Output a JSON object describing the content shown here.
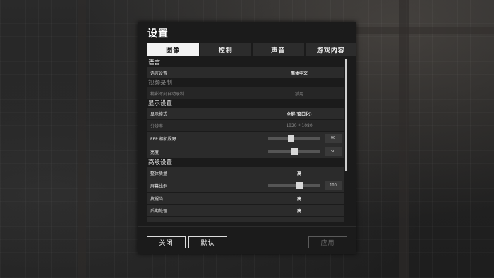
{
  "dialog": {
    "title": "设置"
  },
  "tabs": [
    {
      "label": "图像",
      "active": true
    },
    {
      "label": "控制",
      "active": false
    },
    {
      "label": "声音",
      "active": false
    },
    {
      "label": "游戏内容",
      "active": false
    }
  ],
  "sections": {
    "language": "语言",
    "video_record": "视频录制",
    "display": "显示设置",
    "advanced": "高级设置"
  },
  "rows": {
    "language": {
      "label": "语言设置",
      "value": "简体中文"
    },
    "highlight": {
      "label": "精彩时刻自动录制",
      "value": "禁用"
    },
    "display_mode": {
      "label": "显示模式",
      "value": "全屏(窗口化)"
    },
    "resolution": {
      "label": "分辨率",
      "value": "1920 * 1080"
    },
    "fpp_fov": {
      "label": "FPP 相机视野",
      "value": "90",
      "level": 0.43
    },
    "brightness": {
      "label": "亮度",
      "value": "50",
      "level": 0.5
    },
    "overall_quality": {
      "label": "整体质量",
      "value": "高"
    },
    "screen_scale": {
      "label": "屏幕比例",
      "value": "100",
      "level": 0.6
    },
    "anti_aliasing": {
      "label": "抗锯齿",
      "value": "高"
    },
    "post_processing": {
      "label": "后期处理",
      "value": "高"
    }
  },
  "buttons": {
    "close": "关闭",
    "default": "默认",
    "apply": "应用"
  },
  "colors": {
    "active_tab": "#f2f2f2",
    "row_bg": "#2b2b2b",
    "panel_bg": "#1b1b1b"
  }
}
